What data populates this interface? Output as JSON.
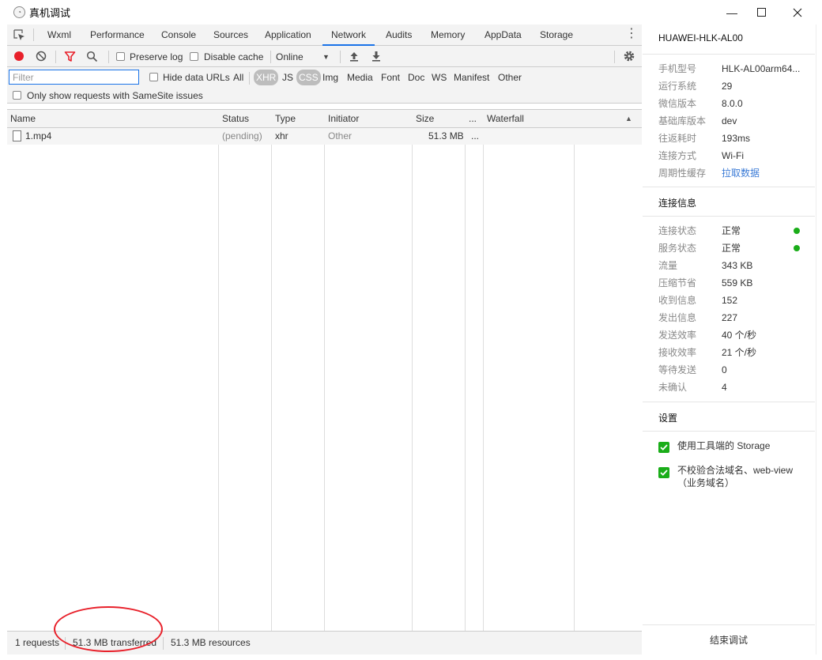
{
  "window": {
    "title": "真机调试",
    "minimize_glyph": "—",
    "maximize_glyph": "☐",
    "close_glyph": "✕"
  },
  "devtools": {
    "tabs": [
      "Wxml",
      "Performance",
      "Console",
      "Sources",
      "Application",
      "Network",
      "Audits",
      "Memory",
      "AppData",
      "Storage"
    ],
    "active_tab": "Network",
    "toolbar": {
      "preserve_log": "Preserve log",
      "disable_cache": "Disable cache",
      "throttling": "Online"
    },
    "filter": {
      "placeholder": "Filter",
      "hide_data_urls": "Hide data URLs",
      "types": [
        "All",
        "XHR",
        "JS",
        "CSS",
        "Img",
        "Media",
        "Font",
        "Doc",
        "WS",
        "Manifest",
        "Other"
      ],
      "selected_types": [
        "XHR",
        "CSS"
      ],
      "samesite": "Only show requests with SameSite issues"
    },
    "table": {
      "columns": [
        "Name",
        "Status",
        "Type",
        "Initiator",
        "Size",
        "...",
        "Waterfall"
      ],
      "rows": [
        {
          "name": "1.mp4",
          "status": "(pending)",
          "type": "xhr",
          "initiator": "Other",
          "size": "51.3 MB",
          "time": "..."
        }
      ]
    },
    "statusbar": {
      "requests": "1 requests",
      "transferred": "51.3 MB transferred",
      "resources": "51.3 MB resources"
    }
  },
  "panel": {
    "device": "HUAWEI-HLK-AL00",
    "info": [
      {
        "k": "手机型号",
        "v": "HLK-AL00arm64..."
      },
      {
        "k": "运行系统",
        "v": "29"
      },
      {
        "k": "微信版本",
        "v": "8.0.0"
      },
      {
        "k": "基础库版本",
        "v": "dev"
      },
      {
        "k": "往返耗时",
        "v": "193ms"
      },
      {
        "k": "连接方式",
        "v": "Wi-Fi"
      },
      {
        "k": "周期性缓存",
        "v": "拉取数据"
      }
    ],
    "conn_title": "连接信息",
    "conn": [
      {
        "k": "连接状态",
        "v": "正常"
      },
      {
        "k": "服务状态",
        "v": "正常"
      },
      {
        "k": "流量",
        "v": "343 KB"
      },
      {
        "k": "压缩节省",
        "v": "559 KB"
      },
      {
        "k": "收到信息",
        "v": "152"
      },
      {
        "k": "发出信息",
        "v": "227"
      },
      {
        "k": "发送效率",
        "v": "40 个/秒"
      },
      {
        "k": "接收效率",
        "v": "21 个/秒"
      },
      {
        "k": "等待发送",
        "v": "0"
      },
      {
        "k": "未确认",
        "v": "4"
      }
    ],
    "settings_title": "设置",
    "settings": [
      {
        "label": "使用工具端的 Storage",
        "checked": true
      },
      {
        "label": "不校验合法域名、web-view（业务域名）",
        "checked": true
      }
    ],
    "end_button": "结束调试"
  },
  "colors": {
    "accent": "#1a73e8",
    "record": "#e8202a",
    "ok_dot": "#1aad19",
    "check_green": "#1aad19",
    "link": "#3b7bd6"
  }
}
